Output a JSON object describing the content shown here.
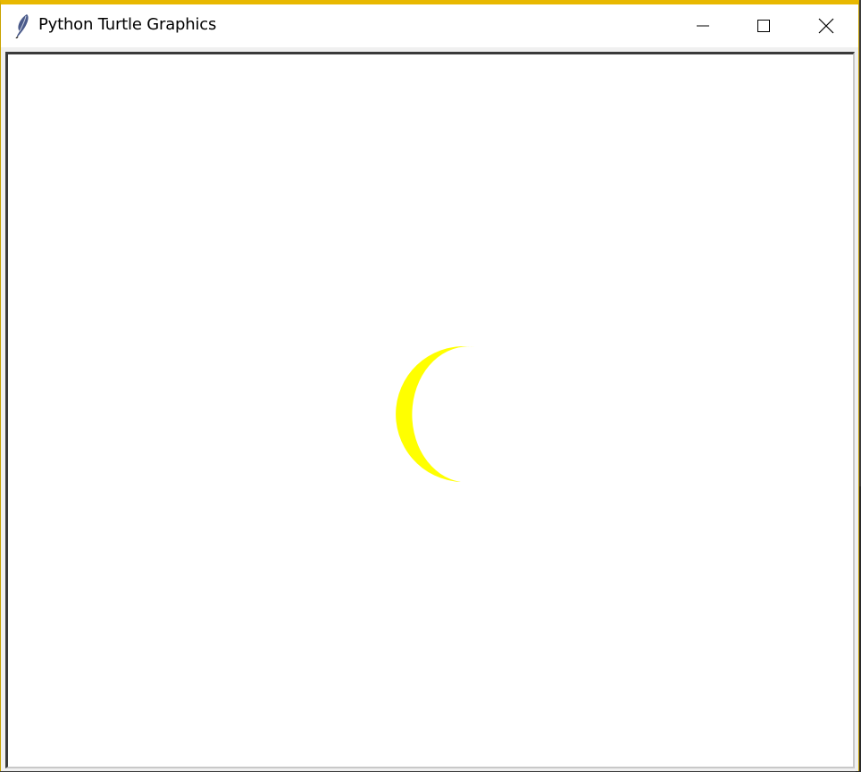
{
  "window": {
    "title": "Python Turtle Graphics",
    "app_icon": "tk-feather-icon",
    "accent_color": "#e8b800"
  },
  "controls": {
    "minimize_icon": "minimize-icon",
    "maximize_icon": "maximize-icon",
    "close_icon": "close-icon"
  },
  "canvas": {
    "background": "#ffffff",
    "drawing": {
      "shape": "crescent-moon",
      "fill_color": "#ffff00"
    }
  }
}
